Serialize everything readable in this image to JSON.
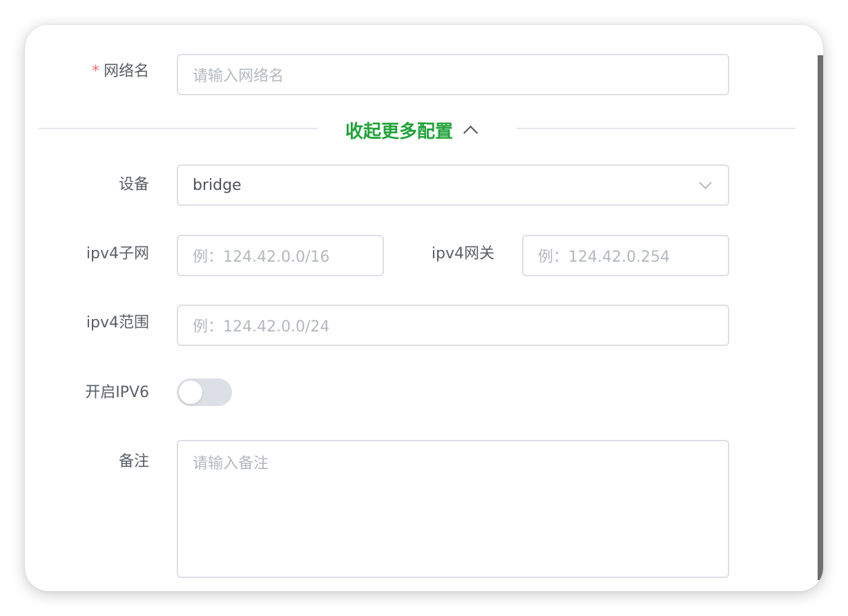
{
  "form": {
    "network_name": {
      "required_mark": "*",
      "label": "网络名",
      "placeholder": "请输入网络名"
    },
    "collapse_toggle": {
      "label": "收起更多配置",
      "icon": "chevron-up-icon"
    },
    "device": {
      "label": "设备",
      "value": "bridge",
      "icon": "chevron-down-icon"
    },
    "ipv4_subnet": {
      "label": "ipv4子网",
      "placeholder": "例：124.42.0.0/16"
    },
    "ipv4_gateway": {
      "label": "ipv4网关",
      "placeholder": "例：124.42.0.254"
    },
    "ipv4_range": {
      "label": "ipv4范围",
      "placeholder": "例：124.42.0.0/24"
    },
    "enable_ipv6": {
      "label": "开启IPV6",
      "enabled": false
    },
    "remark": {
      "label": "备注",
      "placeholder": "请输入备注"
    }
  },
  "colors": {
    "accent": "#21a33a",
    "required": "#f56c6c",
    "border": "#dcdfe6",
    "label_text": "#5a5e66",
    "placeholder_text": "#b4b8bf"
  }
}
